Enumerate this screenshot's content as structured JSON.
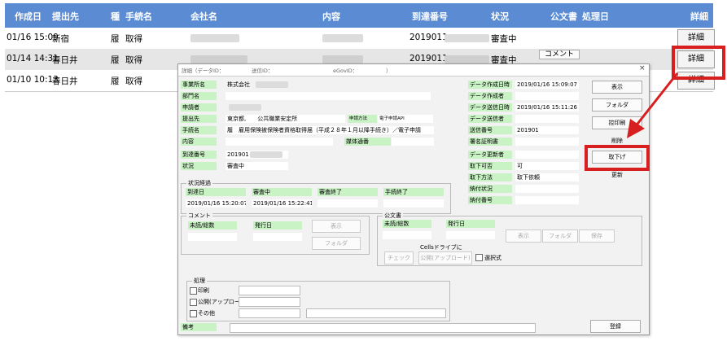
{
  "list": {
    "headers": [
      "作成日",
      "提出先",
      "種",
      "手続名",
      "会社名",
      "内容",
      "到達番号",
      "状況",
      "公文書",
      "処理日",
      "詳細"
    ],
    "rows": [
      {
        "date": "01/16 15:09",
        "dest": "新宿",
        "type": "履",
        "proc": "取得",
        "arrival": "2019011",
        "status": "審査中",
        "doc": "",
        "detail": "詳細"
      },
      {
        "date": "01/14 14:31",
        "dest": "春日井",
        "type": "履",
        "proc": "取得",
        "arrival": "2019011",
        "status": "審査中",
        "doc": "コメント",
        "detail": "詳細"
      },
      {
        "date": "01/10 10:13",
        "dest": "春日井",
        "type": "履",
        "proc": "取得",
        "arrival": "",
        "status": "",
        "doc": "",
        "detail": "詳細"
      }
    ]
  },
  "dialog": {
    "title_prefix": "詳細（データID：",
    "title_mid": "送信ID：",
    "title_egov": "eGovID：",
    "title_suffix": "）",
    "close": "×",
    "fields_left": {
      "office_label": "事業所名",
      "office_value": "株式会社",
      "dept_label": "部門名",
      "dept_value": "",
      "applicant_label": "申請者",
      "applicant_value": "",
      "dest_label": "提出先",
      "dest_value": "東京都,　　公共職業安定所",
      "method_label": "申請方法",
      "method_value": "電子申請API",
      "proc_label": "手続名",
      "proc_value": "履　雇用保険被保険者資格取得届（平成２８年１月以降手続き）／電子申請",
      "content_label": "内容",
      "content_value": "",
      "media_label": "媒体通番",
      "media_value": "",
      "arrival_label": "到達番号",
      "arrival_value": "201901",
      "status_label": "状況",
      "status_value": "審査中"
    },
    "fields_right": {
      "created_label": "データ作成日時",
      "created_value": "2019/01/16 15:09:07",
      "creator_label": "データ作成者",
      "creator_value": "",
      "sent_label": "データ送信日時",
      "sent_value": "2019/01/16 15:11:26",
      "sender_label": "データ送信者",
      "sender_value": "",
      "sendno_label": "送信番号",
      "sendno_value": "201901",
      "cert_label": "署名証明書",
      "cert_value": "",
      "updater_label": "データ更新者",
      "updater_value": "",
      "cancel_ok_label": "取下可否",
      "cancel_ok_value": "可",
      "cancel_method_label": "取下方法",
      "cancel_method_value": "取下依頼",
      "pay_status_label": "納付状況",
      "pay_status_value": "",
      "pay_no_label": "納付番号",
      "pay_no_value": ""
    },
    "side_buttons": [
      "表示",
      "フォルダ",
      "控印刷",
      "削除",
      "取下げ",
      "更新"
    ],
    "progress": {
      "title": "状況経過",
      "labels": [
        "到達日",
        "審査中",
        "審査終了",
        "手続終了"
      ],
      "values": [
        "2019/01/16 15:20:07",
        "2019/01/16 15:22:41",
        "",
        ""
      ]
    },
    "comment": {
      "title": "コメント",
      "read_label": "未読/総数",
      "issued_label": "発行日",
      "show_btn": "表示",
      "folder_btn": "フォルダ"
    },
    "official": {
      "title": "公文書",
      "read_label": "未読/総数",
      "issued_label": "発行日",
      "show_btn": "表示",
      "folder_btn": "フォルダ",
      "save_btn": "保存",
      "cells_label": "Cellsドライブに",
      "check_btn": "チェック",
      "upload_btn": "公開(アップロード)",
      "select_label": "選択式"
    },
    "process": {
      "title": "処理",
      "print_label": "印刷",
      "upload_label": "公開(アップロード)",
      "other_label": "その他"
    },
    "note_label": "備考",
    "register_btn": "登録"
  },
  "colors": {
    "header_bg": "#5b8bd3",
    "label_bg": "#c9f2c5",
    "highlight": "#d81f1f"
  }
}
